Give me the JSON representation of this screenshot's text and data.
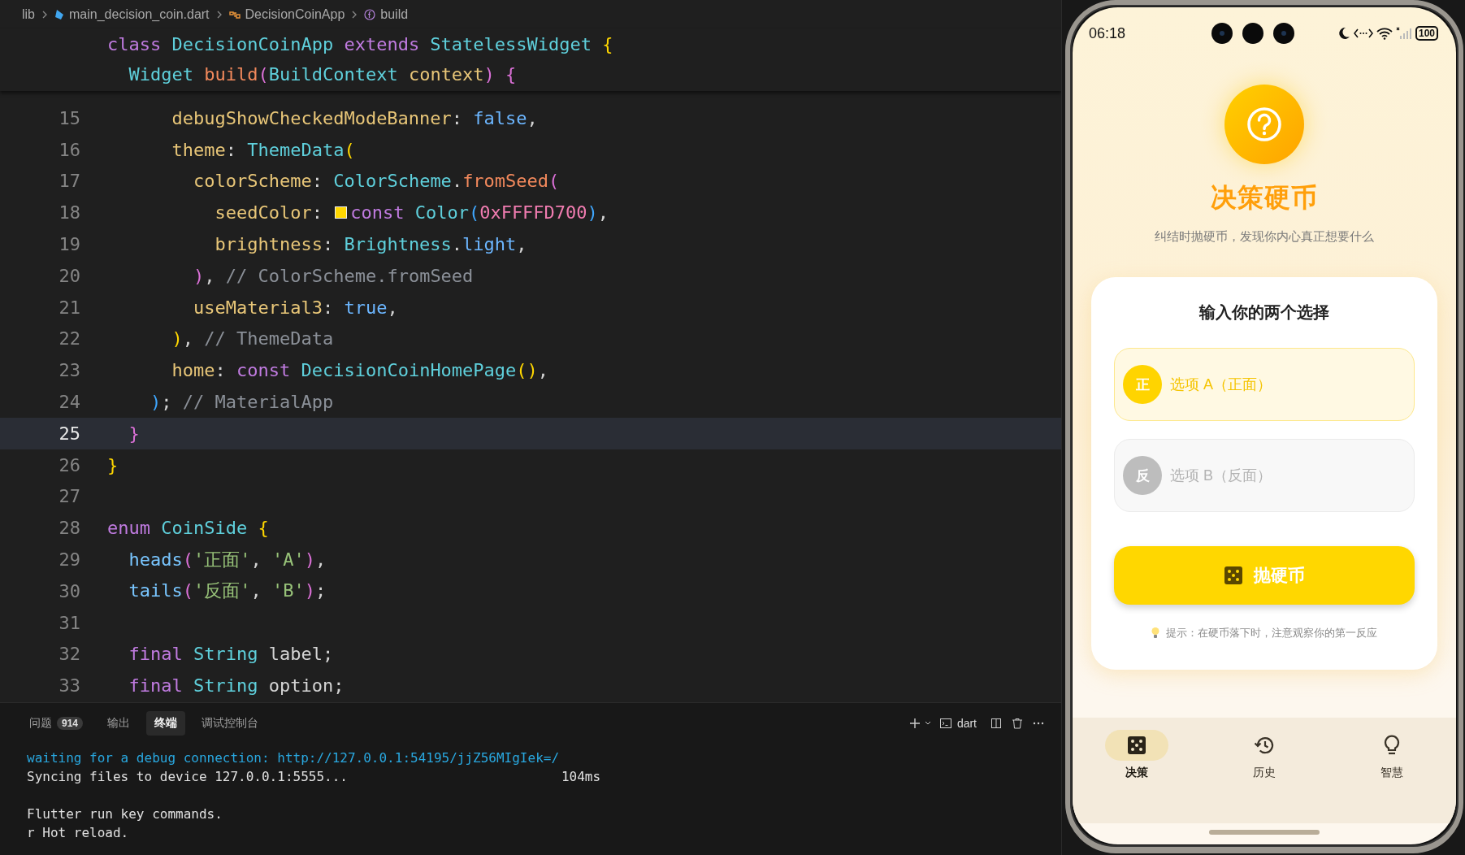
{
  "breadcrumb": [
    {
      "label": "lib",
      "kind": "folder"
    },
    {
      "label": "main_decision_coin.dart",
      "kind": "file"
    },
    {
      "label": "DecisionCoinApp",
      "kind": "class"
    },
    {
      "label": "build",
      "kind": "function"
    }
  ],
  "sticky_lines": [
    {
      "tokens": [
        {
          "kind": "kw",
          "text": "class"
        },
        {
          "kind": "type",
          "text": " DecisionCoinApp "
        },
        {
          "kind": "kw",
          "text": "extends"
        },
        {
          "kind": "type",
          "text": " StatelessWidget "
        },
        {
          "kind": "b1",
          "text": "{"
        }
      ]
    },
    {
      "tokens": [
        {
          "kind": "type",
          "text": "  Widget "
        },
        {
          "kind": "fn",
          "text": "build"
        },
        {
          "kind": "b2",
          "text": "("
        },
        {
          "kind": "type",
          "text": "BuildContext "
        },
        {
          "kind": "prop",
          "text": "context"
        },
        {
          "kind": "b2",
          "text": ") {"
        }
      ]
    }
  ],
  "code_lines": [
    {
      "number": "15",
      "current": false,
      "tokens": [
        {
          "kind": "prop",
          "text": "      debugShowCheckedModeBanner"
        },
        {
          "kind": "plain",
          "text": ": "
        },
        {
          "kind": "bool",
          "text": "false"
        },
        {
          "kind": "plain",
          "text": ","
        }
      ]
    },
    {
      "number": "16",
      "current": false,
      "tokens": [
        {
          "kind": "prop",
          "text": "      theme"
        },
        {
          "kind": "plain",
          "text": ": "
        },
        {
          "kind": "type",
          "text": "ThemeData"
        },
        {
          "kind": "b1",
          "text": "("
        }
      ]
    },
    {
      "number": "17",
      "current": false,
      "tokens": [
        {
          "kind": "prop",
          "text": "        colorScheme"
        },
        {
          "kind": "plain",
          "text": ": "
        },
        {
          "kind": "type",
          "text": "ColorScheme"
        },
        {
          "kind": "plain",
          "text": "."
        },
        {
          "kind": "fn",
          "text": "fromSeed"
        },
        {
          "kind": "b2",
          "text": "("
        }
      ]
    },
    {
      "number": "18",
      "current": false,
      "tokens": [
        {
          "kind": "prop",
          "text": "          seedColor"
        },
        {
          "kind": "plain",
          "text": ": "
        },
        {
          "kind": "swatch",
          "color": "#ffd700"
        },
        {
          "kind": "kw",
          "text": "const "
        },
        {
          "kind": "type",
          "text": "Color"
        },
        {
          "kind": "b3",
          "text": "("
        },
        {
          "kind": "num",
          "text": "0xFFFFD700"
        },
        {
          "kind": "b3",
          "text": ")"
        },
        {
          "kind": "plain",
          "text": ","
        }
      ]
    },
    {
      "number": "19",
      "current": false,
      "tokens": [
        {
          "kind": "prop",
          "text": "          brightness"
        },
        {
          "kind": "plain",
          "text": ": "
        },
        {
          "kind": "type",
          "text": "Brightness"
        },
        {
          "kind": "plain",
          "text": "."
        },
        {
          "kind": "bool",
          "text": "light"
        },
        {
          "kind": "plain",
          "text": ","
        }
      ]
    },
    {
      "number": "20",
      "current": false,
      "tokens": [
        {
          "kind": "b2",
          "text": "        )"
        },
        {
          "kind": "plain",
          "text": ", "
        },
        {
          "kind": "com",
          "text": "// ColorScheme.fromSeed"
        }
      ]
    },
    {
      "number": "21",
      "current": false,
      "tokens": [
        {
          "kind": "prop",
          "text": "        useMaterial3"
        },
        {
          "kind": "plain",
          "text": ": "
        },
        {
          "kind": "bool",
          "text": "true"
        },
        {
          "kind": "plain",
          "text": ","
        }
      ]
    },
    {
      "number": "22",
      "current": false,
      "tokens": [
        {
          "kind": "b1",
          "text": "      )"
        },
        {
          "kind": "plain",
          "text": ", "
        },
        {
          "kind": "com",
          "text": "// ThemeData"
        }
      ]
    },
    {
      "number": "23",
      "current": false,
      "tokens": [
        {
          "kind": "prop",
          "text": "      home"
        },
        {
          "kind": "plain",
          "text": ": "
        },
        {
          "kind": "kw",
          "text": "const "
        },
        {
          "kind": "type",
          "text": "DecisionCoinHomePage"
        },
        {
          "kind": "b1",
          "text": "()"
        },
        {
          "kind": "plain",
          "text": ","
        }
      ]
    },
    {
      "number": "24",
      "current": false,
      "tokens": [
        {
          "kind": "b3",
          "text": "    )"
        },
        {
          "kind": "plain",
          "text": "; "
        },
        {
          "kind": "com",
          "text": "// MaterialApp"
        }
      ]
    },
    {
      "number": "25",
      "current": true,
      "tokens": [
        {
          "kind": "b2",
          "text": "  }"
        }
      ]
    },
    {
      "number": "26",
      "current": false,
      "tokens": [
        {
          "kind": "b1",
          "text": "}"
        }
      ]
    },
    {
      "number": "27",
      "current": false
    },
    {
      "number": "28",
      "current": false,
      "tokens": [
        {
          "kind": "kw",
          "text": "enum "
        },
        {
          "kind": "type",
          "text": "CoinSide "
        },
        {
          "kind": "b1",
          "text": "{"
        }
      ]
    },
    {
      "number": "29",
      "current": false,
      "tokens": [
        {
          "kind": "member",
          "text": "  heads"
        },
        {
          "kind": "b2",
          "text": "("
        },
        {
          "kind": "str",
          "text": "'正面'"
        },
        {
          "kind": "plain",
          "text": ", "
        },
        {
          "kind": "str",
          "text": "'A'"
        },
        {
          "kind": "b2",
          "text": ")"
        },
        {
          "kind": "plain",
          "text": ","
        }
      ]
    },
    {
      "number": "30",
      "current": false,
      "tokens": [
        {
          "kind": "member",
          "text": "  tails"
        },
        {
          "kind": "b2",
          "text": "("
        },
        {
          "kind": "str",
          "text": "'反面'"
        },
        {
          "kind": "plain",
          "text": ", "
        },
        {
          "kind": "str",
          "text": "'B'"
        },
        {
          "kind": "b2",
          "text": ")"
        },
        {
          "kind": "plain",
          "text": ";"
        }
      ]
    },
    {
      "number": "31",
      "current": false
    },
    {
      "number": "32",
      "current": false,
      "tokens": [
        {
          "kind": "kw",
          "text": "  final "
        },
        {
          "kind": "type",
          "text": "String "
        },
        {
          "kind": "plain",
          "text": "label;"
        }
      ]
    },
    {
      "number": "33",
      "current": false,
      "tokens": [
        {
          "kind": "kw",
          "text": "  final "
        },
        {
          "kind": "type",
          "text": "String "
        },
        {
          "kind": "plain",
          "text": "option;"
        }
      ]
    }
  ],
  "panel": {
    "tabs": [
      {
        "label": "问题",
        "badge": "914",
        "selected": false
      },
      {
        "label": "输出",
        "selected": false
      },
      {
        "label": "终端",
        "selected": true
      },
      {
        "label": "调试控制台",
        "selected": false
      }
    ],
    "shell": "dart",
    "terminal": [
      {
        "kind": "link",
        "text": "waiting for a debug connection: http://127.0.0.1:54195/jjZ56MIgIek=/"
      },
      {
        "kind": "plain",
        "text": "Syncing files to device 127.0.0.1:5555...",
        "time": "104ms"
      },
      {
        "kind": "blank"
      },
      {
        "kind": "plain",
        "text": "Flutter run key commands."
      },
      {
        "kind": "plain",
        "text": "r Hot reload."
      }
    ]
  },
  "phone": {
    "time": "06:18",
    "battery": "100",
    "title": "决策硬币",
    "subtitle": "纠结时抛硬币，发现你内心真正想要什么",
    "card": {
      "heading": "输入你的两个选择",
      "options": [
        {
          "kind": "heads",
          "badge": "正",
          "placeholder": "选项 A（正面）"
        },
        {
          "kind": "tails",
          "badge": "反",
          "placeholder": "选项 B（反面）"
        }
      ],
      "button": "抛硬币",
      "hint": "提示：在硬币落下时，注意观察你的第一反应"
    },
    "nav": [
      {
        "label": "决策",
        "kind": "dice",
        "selected": true
      },
      {
        "label": "历史",
        "kind": "history",
        "selected": false
      },
      {
        "label": "智慧",
        "kind": "bulb",
        "selected": false
      }
    ]
  }
}
